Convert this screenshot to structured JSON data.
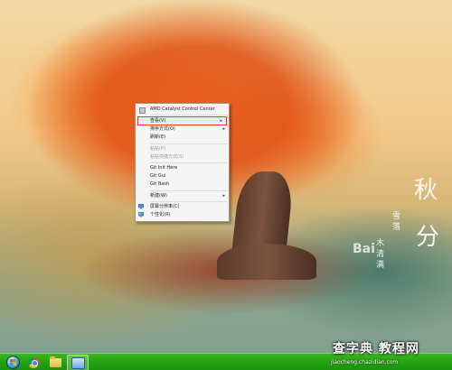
{
  "desktop": {
    "wallpaper": "autumn-tree-painting",
    "signature_big": [
      "秋",
      "分"
    ],
    "signature_small": [
      "木",
      "清",
      "满",
      "雪",
      "落",
      "秋",
      "声",
      "梦",
      "里",
      "染"
    ],
    "baidu_mark": "Bai"
  },
  "context_menu": {
    "items": [
      {
        "label": "AMD Catalyst Control Center",
        "icon": "amd-icon",
        "enabled": true
      },
      {
        "label": "查看(V)",
        "submenu": true,
        "highlighted": true,
        "enabled": true
      },
      {
        "label": "排序方式(O)",
        "submenu": true,
        "enabled": true
      },
      {
        "label": "刷新(E)",
        "enabled": true
      },
      {
        "label": "粘贴(P)",
        "enabled": false
      },
      {
        "label": "粘贴快捷方式(S)",
        "enabled": false
      },
      {
        "label": "Git Init Here",
        "enabled": true
      },
      {
        "label": "Git Gui",
        "enabled": true
      },
      {
        "label": "Git Bash",
        "enabled": true
      },
      {
        "label": "新建(W)",
        "submenu": true,
        "enabled": true
      },
      {
        "label": "屏幕分辨率(C)",
        "icon": "display-icon",
        "enabled": true
      },
      {
        "label": "个性化(R)",
        "icon": "personalize-icon",
        "enabled": true
      }
    ],
    "submenu_arrow": "▸"
  },
  "taskbar": {
    "color": "#24a212",
    "buttons": [
      "start-orb",
      "chrome-icon",
      "folder-icon",
      "app-icon"
    ]
  },
  "watermark": {
    "logo": "查字典 教程网",
    "url": "jiaocheng.chazidian.com"
  }
}
